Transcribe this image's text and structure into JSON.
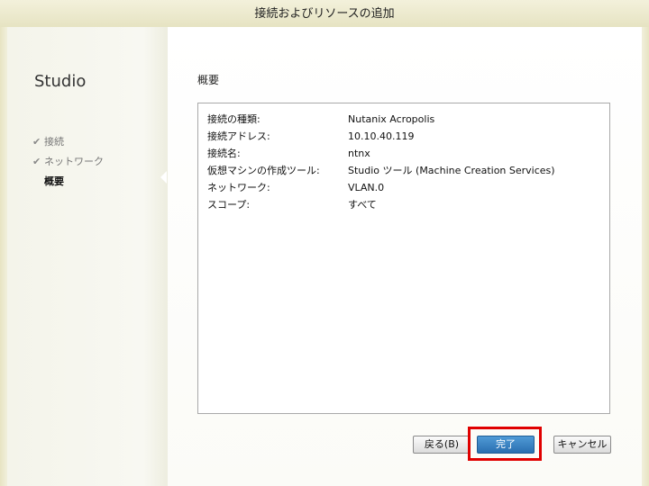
{
  "window": {
    "title": "接続およびリソースの追加"
  },
  "sidebar": {
    "heading": "Studio",
    "steps": [
      {
        "label": "接続",
        "completed": true
      },
      {
        "label": "ネットワーク",
        "completed": true
      },
      {
        "label": "概要",
        "completed": false,
        "current": true
      }
    ]
  },
  "main": {
    "section_title": "概要",
    "summary": [
      {
        "label": "接続の種類:",
        "value": "Nutanix Acropolis"
      },
      {
        "label": "接続アドレス:",
        "value": "10.10.40.119"
      },
      {
        "label": "接続名:",
        "value": "ntnx"
      },
      {
        "label": "仮想マシンの作成ツール:",
        "value": "Studio ツール (Machine Creation Services)"
      },
      {
        "label": "ネットワーク:",
        "value": "VLAN.0"
      },
      {
        "label": "スコープ:",
        "value": "すべて"
      }
    ]
  },
  "buttons": {
    "back": "戻る(B)",
    "finish": "完了",
    "cancel": "キャンセル"
  },
  "colors": {
    "accent": "#2a6fb0",
    "highlight": "#e00000"
  }
}
